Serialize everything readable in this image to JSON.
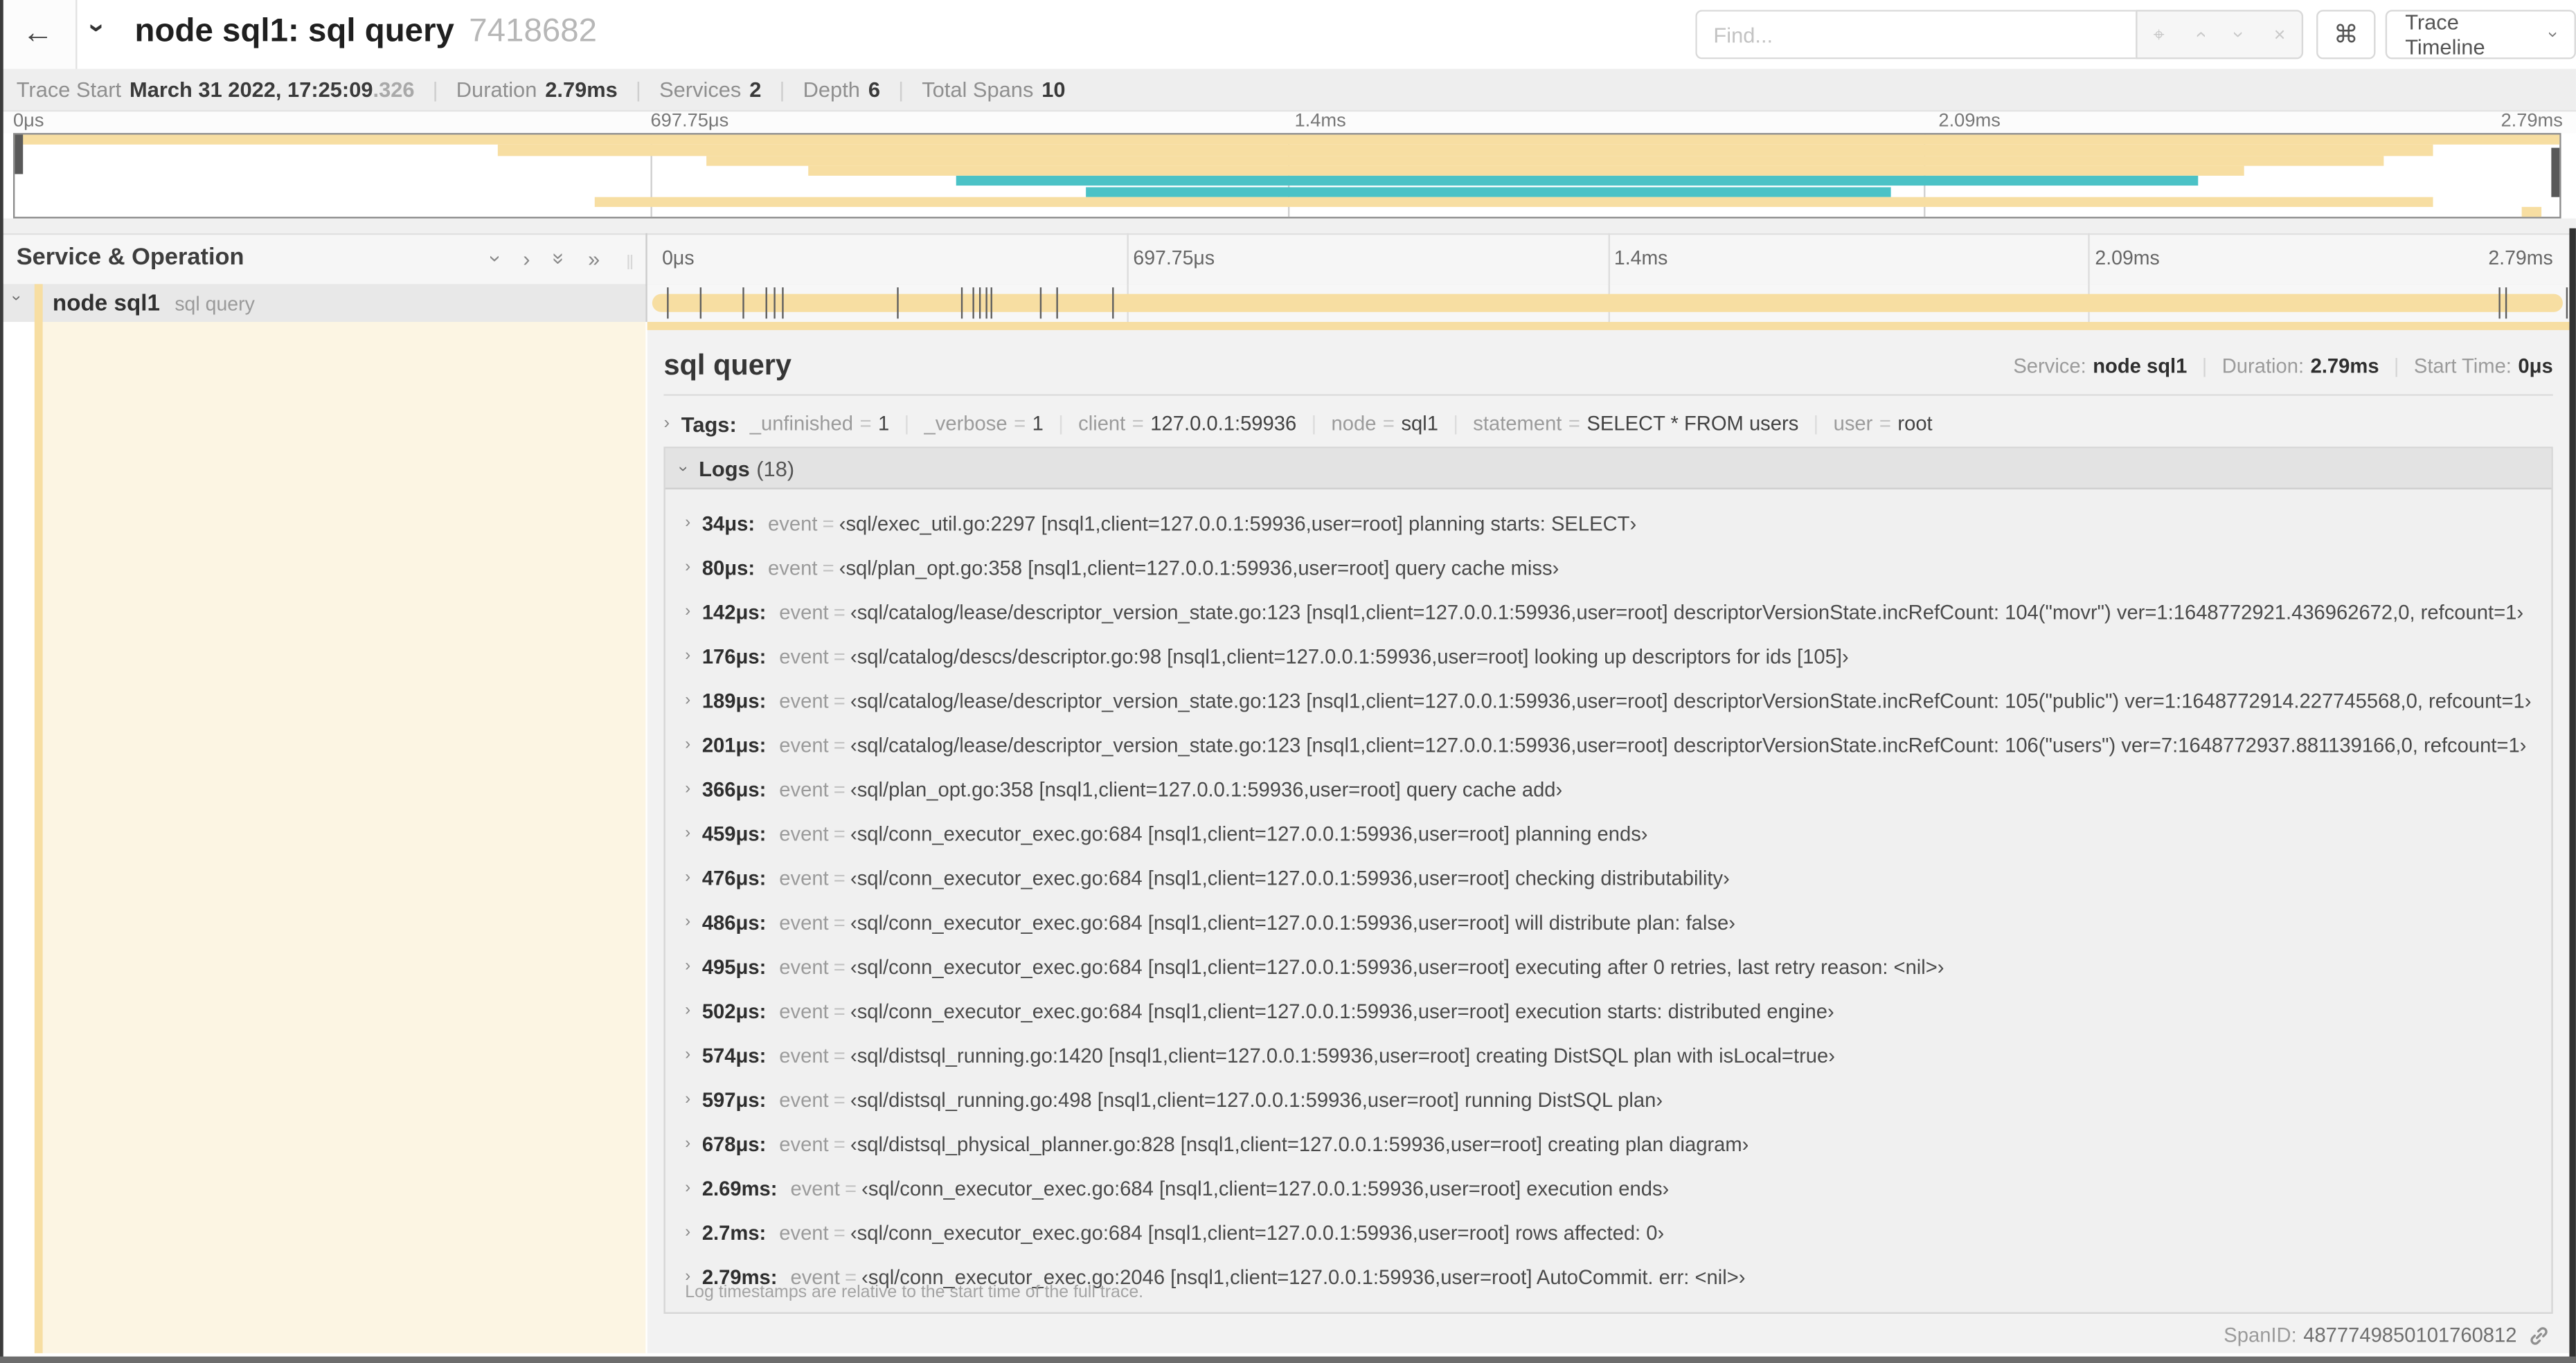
{
  "header": {
    "back_icon": "arrow-left",
    "title": "node sql1: sql query",
    "trace_id": "7418682",
    "find_placeholder": "Find...",
    "keyboard_shortcut_label": "⌘",
    "view_select_label": "Trace Timeline"
  },
  "trace_info": [
    {
      "label": "Trace Start",
      "value": "March 31 2022, 17:25:09",
      "suffix": ".326"
    },
    {
      "label": "Duration",
      "value": "2.79ms",
      "suffix": ""
    },
    {
      "label": "Services",
      "value": "2",
      "suffix": ""
    },
    {
      "label": "Depth",
      "value": "6",
      "suffix": ""
    },
    {
      "label": "Total Spans",
      "value": "10",
      "suffix": ""
    }
  ],
  "ticks": [
    {
      "label": "0μs",
      "pos": 0
    },
    {
      "label": "697.75μs",
      "pos": 25
    },
    {
      "label": "1.4ms",
      "pos": 50
    },
    {
      "label": "2.09ms",
      "pos": 75
    },
    {
      "label": "2.79ms",
      "pos": 100
    }
  ],
  "minimap": {
    "gridlines": [
      25,
      50,
      75
    ],
    "spans": [
      {
        "row": 0,
        "start": 0.0,
        "end": 1.0,
        "color": "orange"
      },
      {
        "row": 1,
        "start": 0.19,
        "end": 0.95,
        "color": "orange"
      },
      {
        "row": 2,
        "start": 0.272,
        "end": 0.931,
        "color": "orange"
      },
      {
        "row": 3,
        "start": 0.312,
        "end": 0.876,
        "color": "orange"
      },
      {
        "row": 4,
        "start": 0.37,
        "end": 0.858,
        "color": "teal"
      },
      {
        "row": 5,
        "start": 0.421,
        "end": 0.737,
        "color": "teal"
      },
      {
        "row": 6,
        "start": 0.228,
        "end": 0.95,
        "color": "orange"
      },
      {
        "row": 7,
        "start": 0.985,
        "end": 0.993,
        "color": "orange"
      }
    ]
  },
  "timeline": {
    "header_label": "Service & Operation",
    "row": {
      "service": "node sql1",
      "operation": "sql query"
    },
    "log_markers": [
      0.0122,
      0.0287,
      0.0509,
      0.0631,
      0.0677,
      0.072,
      0.1312,
      0.1645,
      0.1706,
      0.1742,
      0.1774,
      0.1799,
      0.2057,
      0.214,
      0.243,
      0.9642,
      0.9677,
      0.999
    ]
  },
  "detail": {
    "title": "sql query",
    "service_label": "Service:",
    "service": "node sql1",
    "duration_label": "Duration:",
    "duration": "2.79ms",
    "start_label": "Start Time:",
    "start": "0μs",
    "tags_label": "Tags:",
    "tags": [
      {
        "key": "_unfinished",
        "value": "1"
      },
      {
        "key": "_verbose",
        "value": "1"
      },
      {
        "key": "client",
        "value": "127.0.0.1:59936"
      },
      {
        "key": "node",
        "value": "sql1"
      },
      {
        "key": "statement",
        "value": "SELECT * FROM users"
      },
      {
        "key": "user",
        "value": "root"
      }
    ],
    "logs_label": "Logs",
    "logs_count": "(18)",
    "logs": [
      {
        "t": "34μs:",
        "key": "event",
        "value": "‹sql/exec_util.go:2297 [nsql1,client=127.0.0.1:59936,user=root] planning starts: SELECT›"
      },
      {
        "t": "80μs:",
        "key": "event",
        "value": "‹sql/plan_opt.go:358 [nsql1,client=127.0.0.1:59936,user=root] query cache miss›"
      },
      {
        "t": "142μs:",
        "key": "event",
        "value": "‹sql/catalog/lease/descriptor_version_state.go:123 [nsql1,client=127.0.0.1:59936,user=root] descriptorVersionState.incRefCount: 104(\"movr\") ver=1:1648772921.436962672,0, refcount=1›"
      },
      {
        "t": "176μs:",
        "key": "event",
        "value": "‹sql/catalog/descs/descriptor.go:98 [nsql1,client=127.0.0.1:59936,user=root] looking up descriptors for ids [105]›"
      },
      {
        "t": "189μs:",
        "key": "event",
        "value": "‹sql/catalog/lease/descriptor_version_state.go:123 [nsql1,client=127.0.0.1:59936,user=root] descriptorVersionState.incRefCount: 105(\"public\") ver=1:1648772914.227745568,0, refcount=1›"
      },
      {
        "t": "201μs:",
        "key": "event",
        "value": "‹sql/catalog/lease/descriptor_version_state.go:123 [nsql1,client=127.0.0.1:59936,user=root] descriptorVersionState.incRefCount: 106(\"users\") ver=7:1648772937.881139166,0, refcount=1›"
      },
      {
        "t": "366μs:",
        "key": "event",
        "value": "‹sql/plan_opt.go:358 [nsql1,client=127.0.0.1:59936,user=root] query cache add›"
      },
      {
        "t": "459μs:",
        "key": "event",
        "value": "‹sql/conn_executor_exec.go:684 [nsql1,client=127.0.0.1:59936,user=root] planning ends›"
      },
      {
        "t": "476μs:",
        "key": "event",
        "value": "‹sql/conn_executor_exec.go:684 [nsql1,client=127.0.0.1:59936,user=root] checking distributability›"
      },
      {
        "t": "486μs:",
        "key": "event",
        "value": "‹sql/conn_executor_exec.go:684 [nsql1,client=127.0.0.1:59936,user=root] will distribute plan: false›"
      },
      {
        "t": "495μs:",
        "key": "event",
        "value": "‹sql/conn_executor_exec.go:684 [nsql1,client=127.0.0.1:59936,user=root] executing after 0 retries, last retry reason: <nil>›"
      },
      {
        "t": "502μs:",
        "key": "event",
        "value": "‹sql/conn_executor_exec.go:684 [nsql1,client=127.0.0.1:59936,user=root] execution starts: distributed engine›"
      },
      {
        "t": "574μs:",
        "key": "event",
        "value": "‹sql/distsql_running.go:1420 [nsql1,client=127.0.0.1:59936,user=root] creating DistSQL plan with isLocal=true›"
      },
      {
        "t": "597μs:",
        "key": "event",
        "value": "‹sql/distsql_running.go:498 [nsql1,client=127.0.0.1:59936,user=root] running DistSQL plan›"
      },
      {
        "t": "678μs:",
        "key": "event",
        "value": "‹sql/distsql_physical_planner.go:828 [nsql1,client=127.0.0.1:59936,user=root] creating plan diagram›"
      },
      {
        "t": "2.69ms:",
        "key": "event",
        "value": "‹sql/conn_executor_exec.go:684 [nsql1,client=127.0.0.1:59936,user=root] execution ends›"
      },
      {
        "t": "2.7ms:",
        "key": "event",
        "value": "‹sql/conn_executor_exec.go:684 [nsql1,client=127.0.0.1:59936,user=root] rows affected: 0›"
      },
      {
        "t": "2.79ms:",
        "key": "event",
        "value": "‹sql/conn_executor_exec.go:2046 [nsql1,client=127.0.0.1:59936,user=root] AutoCommit. err: <nil>›"
      }
    ],
    "footer": "Log timestamps are relative to the start time of the full trace.",
    "span_id_label": "SpanID:",
    "span_id": "4877749850101760812"
  },
  "colors": {
    "orange": "#F7DEA2",
    "orange_tint": "#FCF5E3",
    "teal": "#4BC2C6",
    "row_gray": "#e8e8e8",
    "panel_gray": "#f2f2f2"
  }
}
